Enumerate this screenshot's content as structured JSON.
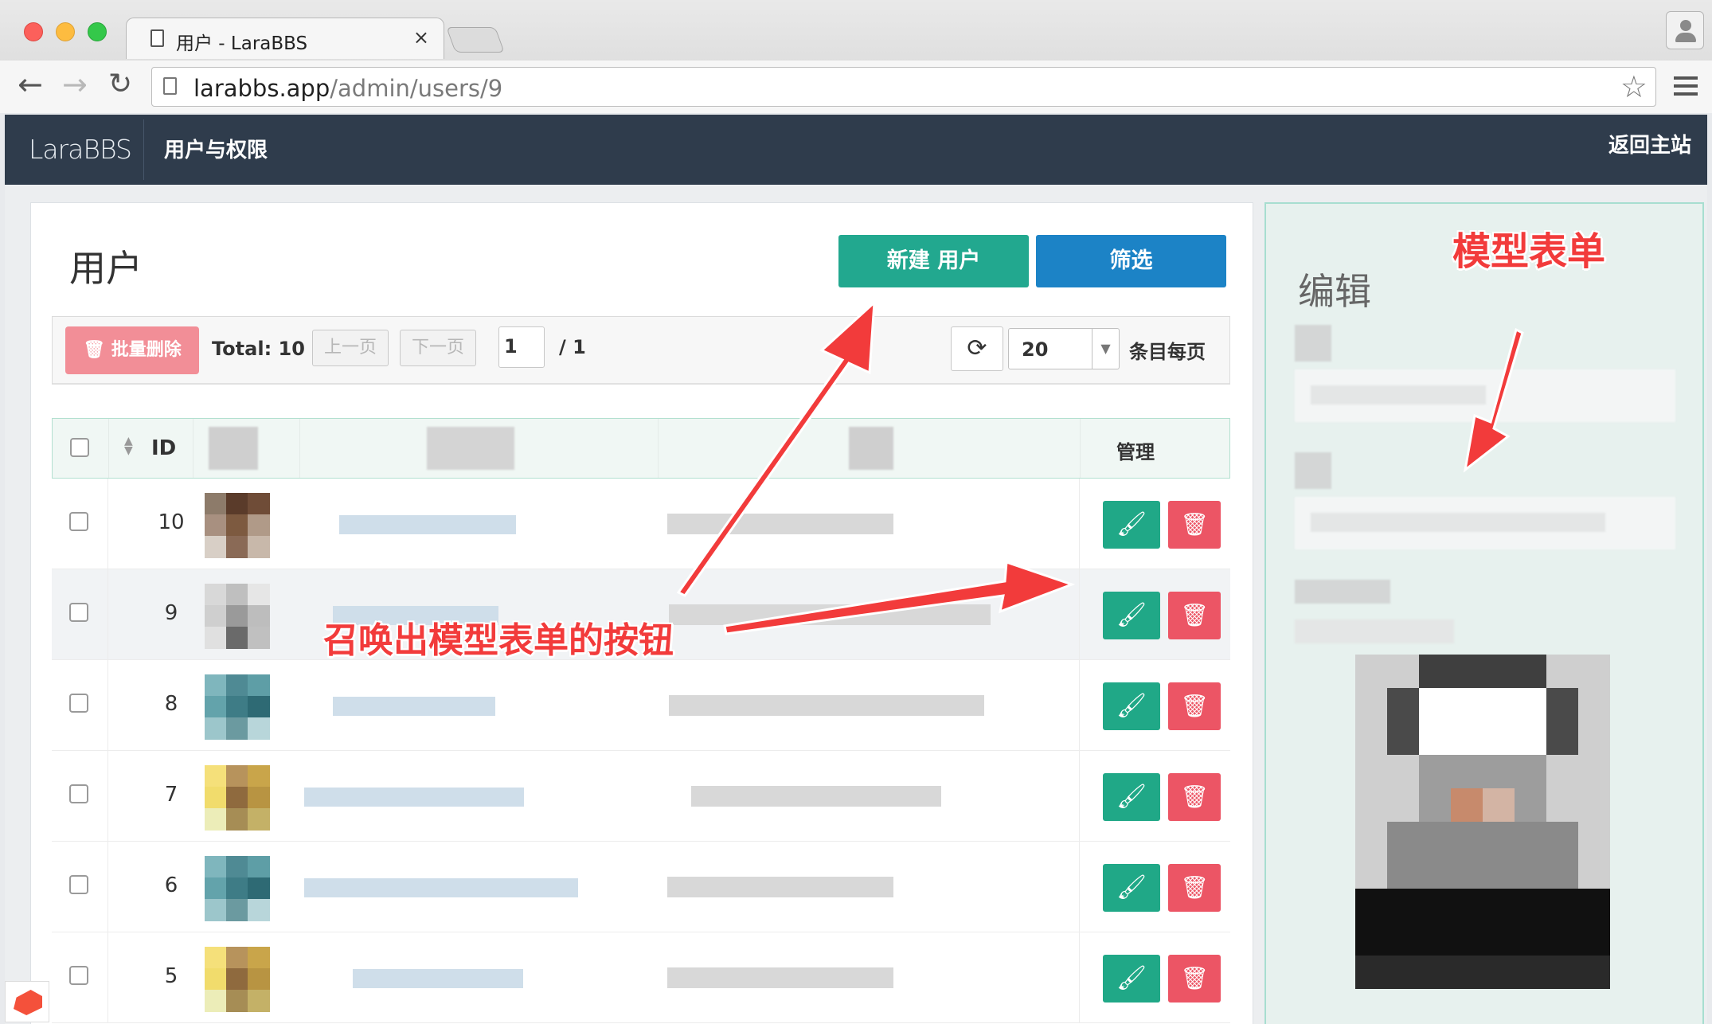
{
  "browser": {
    "tab_title": "用户 - LaraBBS",
    "tab_close": "×",
    "url_host": "larabbs.app",
    "url_path": "/admin/users/9",
    "back": "←",
    "forward": "→",
    "reload": "↻",
    "star": "☆"
  },
  "navbar": {
    "brand": "LaraBBS",
    "menu_item": "用户与权限",
    "home_link": "返回主站"
  },
  "page": {
    "title": "用户",
    "new_button": "新建 用户",
    "filter_button": "筛选"
  },
  "listbar": {
    "bulk_delete": "批量删除",
    "bulk_icon": "trash-icon",
    "total": "Total: 10",
    "prev": "上一页",
    "next": "下一页",
    "current_page": "1",
    "page_count": "/ 1",
    "refresh_icon": "refresh-icon",
    "per_page": "20",
    "per_page_label": "条目每页"
  },
  "table": {
    "headers": {
      "id": "ID",
      "manage": "管理"
    },
    "rows": [
      {
        "id": "10",
        "avatar": [
          "#8d7b6a",
          "#5a3b2a",
          "#6f4c37",
          "#a89080",
          "#7d5a40",
          "#b09a88",
          "#d8cfc6",
          "#8a6a56",
          "#c8b8aa"
        ]
      },
      {
        "id": "9",
        "avatar": [
          "#d8d8d8",
          "#bfbfbf",
          "#e6e6e6",
          "#cfcfcf",
          "#9a9a9a",
          "#bdbdbd",
          "#e0e0e0",
          "#6a6a6a",
          "#c0c0c0"
        ]
      },
      {
        "id": "8",
        "avatar": [
          "#7fb6bd",
          "#4f8a94",
          "#5e9ea6",
          "#63a3ab",
          "#3e7c86",
          "#2e6a74",
          "#9cc6cb",
          "#6b9aa0",
          "#b8d6da"
        ]
      },
      {
        "id": "7",
        "avatar": [
          "#f5e07a",
          "#b7935c",
          "#c9a54a",
          "#f1dc6c",
          "#8f6a3e",
          "#b89442",
          "#ecedb8",
          "#a68d55",
          "#c4b167"
        ]
      },
      {
        "id": "6",
        "avatar": [
          "#7fb6bd",
          "#4f8a94",
          "#5e9ea6",
          "#63a3ab",
          "#3e7c86",
          "#2e6a74",
          "#9cc6cb",
          "#6b9aa0",
          "#b8d6da"
        ]
      },
      {
        "id": "5",
        "avatar": [
          "#f5e07a",
          "#b7935c",
          "#c9a54a",
          "#f1dc6c",
          "#8f6a3e",
          "#b89442",
          "#ecedb8",
          "#a68d55",
          "#c4b167"
        ]
      }
    ]
  },
  "side_panel": {
    "title": "编辑"
  },
  "annotations": {
    "model_form": "模型表单",
    "summon_button": "召唤出模型表单的按钮"
  },
  "colors": {
    "navbar_bg": "#2f3c4c",
    "primary_green": "#22a88f",
    "primary_blue": "#1c83c6",
    "danger_red": "#ec5565",
    "annotation_red": "#f23b3b"
  }
}
